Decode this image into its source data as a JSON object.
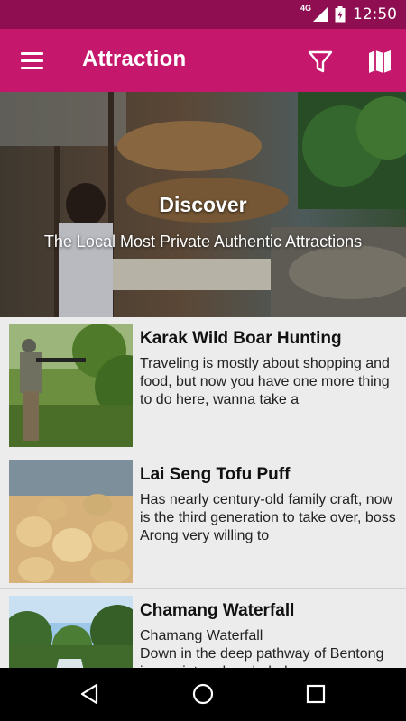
{
  "status_bar": {
    "network": "4G",
    "time": "12:50"
  },
  "app_bar": {
    "title": "Attraction"
  },
  "banner": {
    "heading": "Discover",
    "subheading": "The Local Most Private Authentic Attractions"
  },
  "attractions": [
    {
      "title": "Karak Wild Boar Hunting",
      "description": "Traveling is mostly about shopping and food, but now you have one more thing to do here, wanna take a"
    },
    {
      "title": "Lai Seng Tofu Puff",
      "description": "Has nearly century-old family craft, now is the third generation to take over, boss Arong very willing to"
    },
    {
      "title": "Chamang Waterfall",
      "description": "Chamang Waterfall\nDown in the deep pathway of Bentong is a quiet and secluded"
    }
  ],
  "colors": {
    "status_bar": "#8f0e51",
    "app_bar": "#c5176b",
    "list_bg": "#ececec"
  }
}
